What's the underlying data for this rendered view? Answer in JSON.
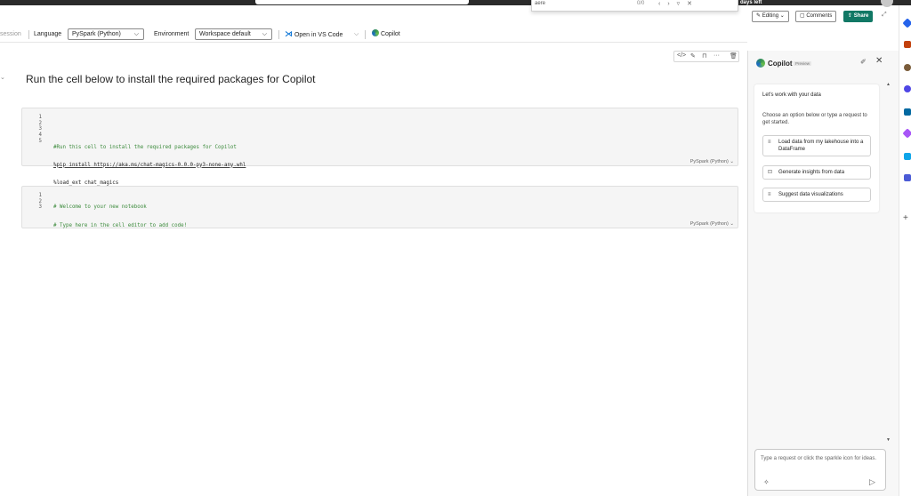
{
  "browser": {
    "find_query": "aere",
    "find_count": "0/0",
    "trial_text": "days left"
  },
  "header_actions": {
    "editing": "Editing ⌄",
    "comments": "Comments",
    "share": "Share"
  },
  "toolbar": {
    "session_fragment": "session",
    "language_label": "Language",
    "language_value": "PySpark (Python)",
    "environment_label": "Environment",
    "environment_value": "Workspace default",
    "vscode": "Open in VS Code",
    "copilot": "Copilot"
  },
  "notebook": {
    "markdown_title": "Run the cell below to install the required packages for Copilot",
    "cell1": {
      "line_numbers": [
        "1",
        "2",
        "3",
        "4",
        "5"
      ],
      "lines": [
        "",
        "#Run this cell to install the required packages for Copilot",
        "%pip install https://aka.ms/chat-magics-0.0.0-py3-none-any.whl",
        "%load_ext chat_magics",
        ""
      ],
      "language": "PySpark (Python) ⌄"
    },
    "cell2": {
      "line_numbers": [
        "1",
        "2",
        "3"
      ],
      "lines": [
        "# Welcome to your new notebook",
        "# Type here in the cell editor to add code!",
        ""
      ],
      "language": "PySpark (Python) ⌄"
    }
  },
  "copilot": {
    "title": "Copilot",
    "badge": "Preview",
    "heading": "Let's work with your data",
    "intro": "Choose an option below or type a request to get started.",
    "options": [
      "Load data from my lakehouse into a DataFrame",
      "Generate insights from data",
      "Suggest data visualizations"
    ],
    "input_placeholder": "Type a request or click the sparkle icon for ideas."
  },
  "colors": {
    "accent_green": "#117865",
    "comment_green": "#3b8a3b",
    "vscode_blue": "#0a74d6"
  }
}
